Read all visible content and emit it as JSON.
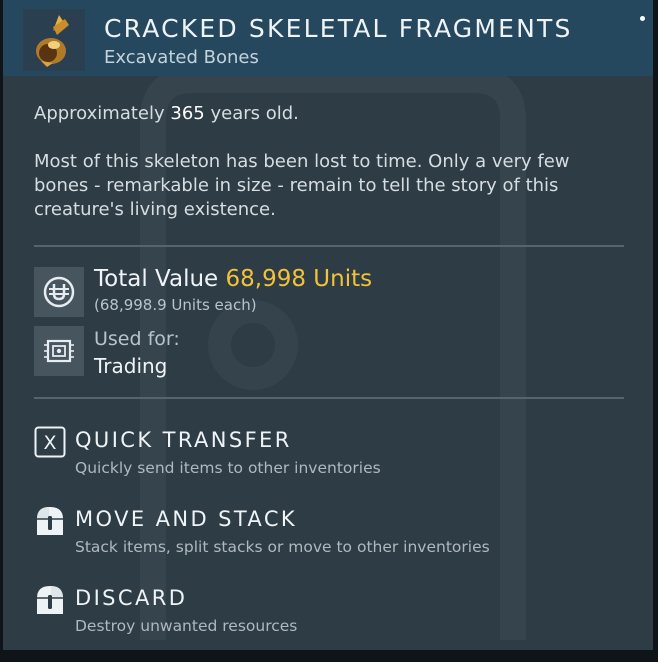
{
  "item": {
    "name": "CRACKED SKELETAL FRAGMENTS",
    "category": "Excavated Bones",
    "age_prefix": "Approximately",
    "age_value": "365",
    "age_suffix": "years old.",
    "description": "Most of this skeleton has been lost to time. Only a very few bones - remarkable in size - remain to tell the story of this creature's living existence.",
    "icon": "fossil-bone-icon"
  },
  "stats": {
    "total_value_label": "Total Value",
    "total_value": "68,998 Units",
    "each_value": "(68,998.9 Units each)",
    "value_icon": "units-currency-icon",
    "used_for_label": "Used for:",
    "used_for_value": "Trading",
    "used_for_icon": "trade-chip-icon"
  },
  "actions": [
    {
      "key": "X",
      "title": "QUICK TRANSFER",
      "desc": "Quickly send items to other inventories",
      "icon": "x-key-icon"
    },
    {
      "title": "MOVE AND STACK",
      "desc": "Stack items, split stacks or move to other inventories",
      "icon": "mouse-left-click-icon"
    },
    {
      "title": "DISCARD",
      "desc": "Destroy unwanted resources",
      "icon": "mouse-right-click-icon"
    }
  ],
  "colors": {
    "panel": "#2e3c45",
    "header": "#26485f",
    "accent_units": "#f2c23a"
  }
}
